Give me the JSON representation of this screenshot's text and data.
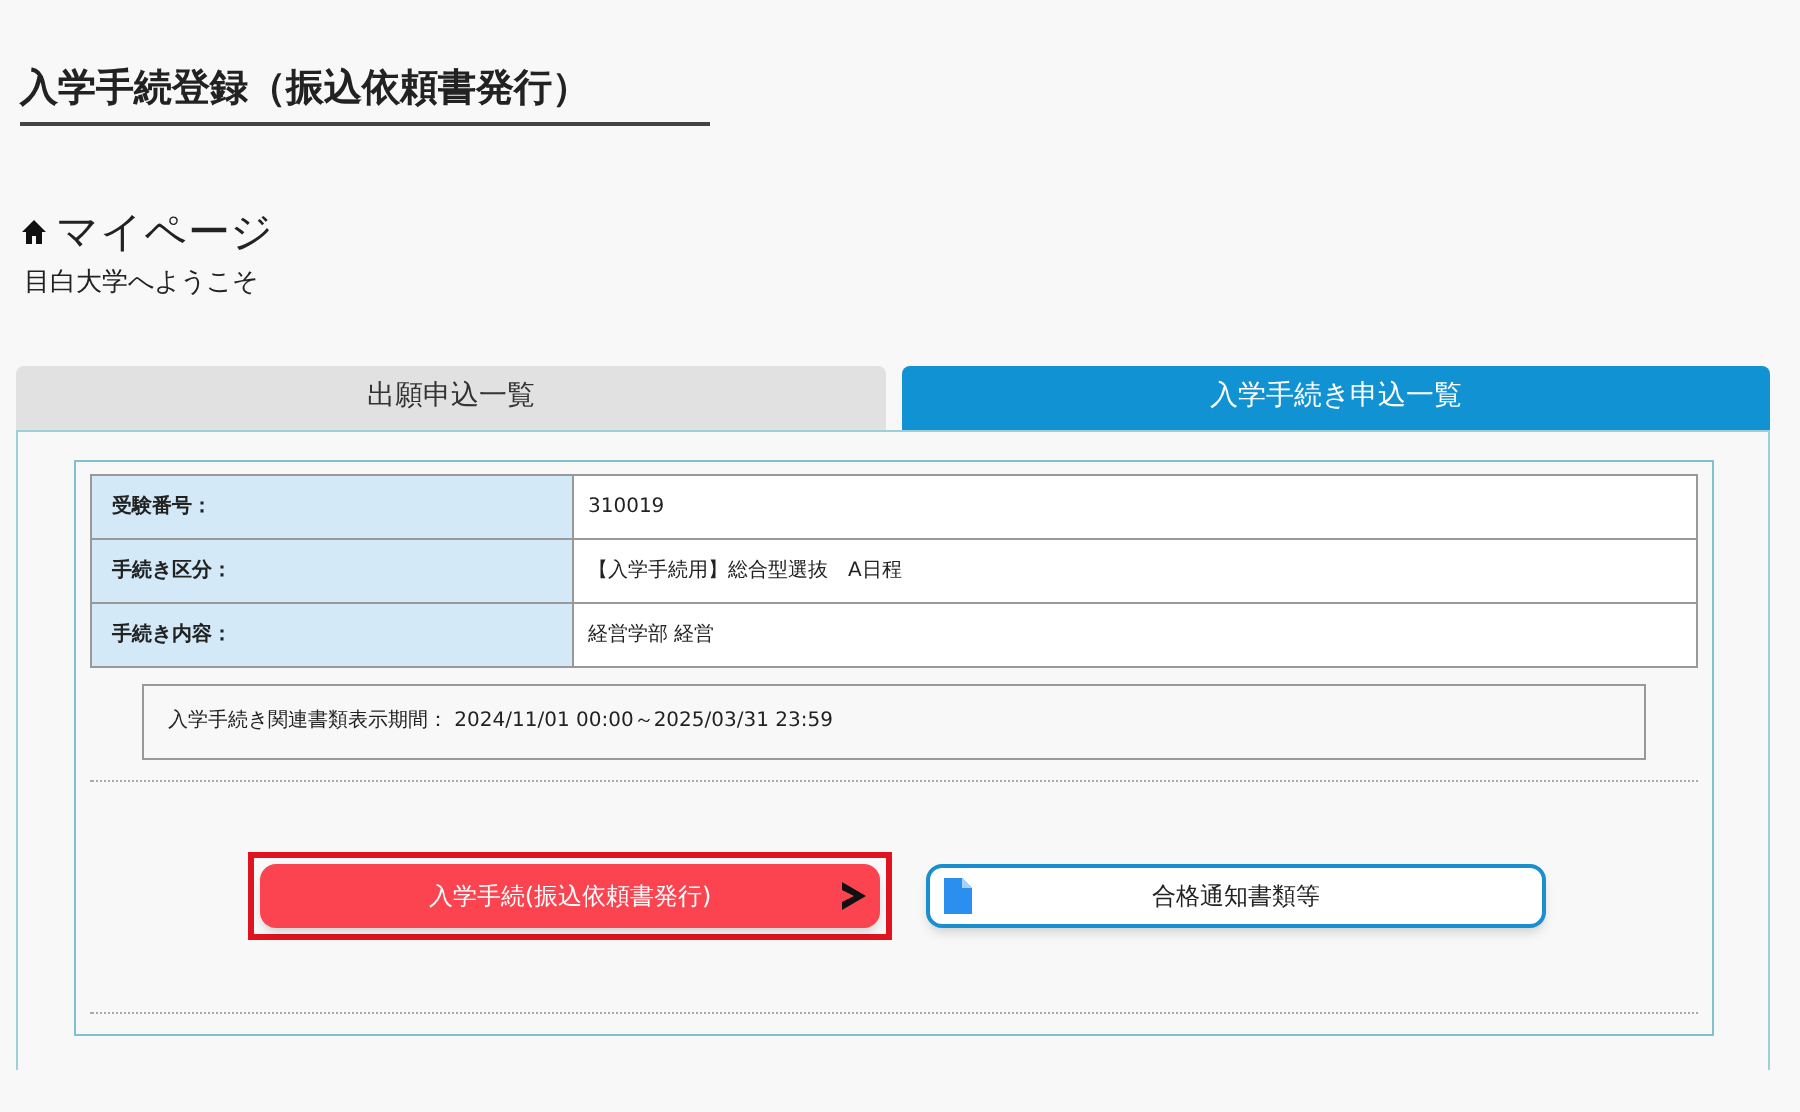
{
  "page_title": "入学手続登録（振込依頼書発行）",
  "heading": "マイページ",
  "welcome": "目白大学へようこそ",
  "tabs": [
    {
      "label": "出願申込一覧",
      "selected": false
    },
    {
      "label": "入学手続き申込一覧",
      "selected": true
    }
  ],
  "details": [
    {
      "label": "受験番号：",
      "value": "310019"
    },
    {
      "label": "手続き区分：",
      "value": "【入学手続用】総合型選抜　A日程"
    },
    {
      "label": "手続き内容：",
      "value": "経営学部 経営"
    }
  ],
  "period": "入学手続き関連書類表示期間： 2024/11/01 00:00～2025/03/31 23:59",
  "buttons": [
    {
      "kind": "primary",
      "label": "入学手続(振込依頼書発行)",
      "highlighted": true
    },
    {
      "kind": "document",
      "label": "合格通知書類等",
      "highlighted": false
    }
  ]
}
